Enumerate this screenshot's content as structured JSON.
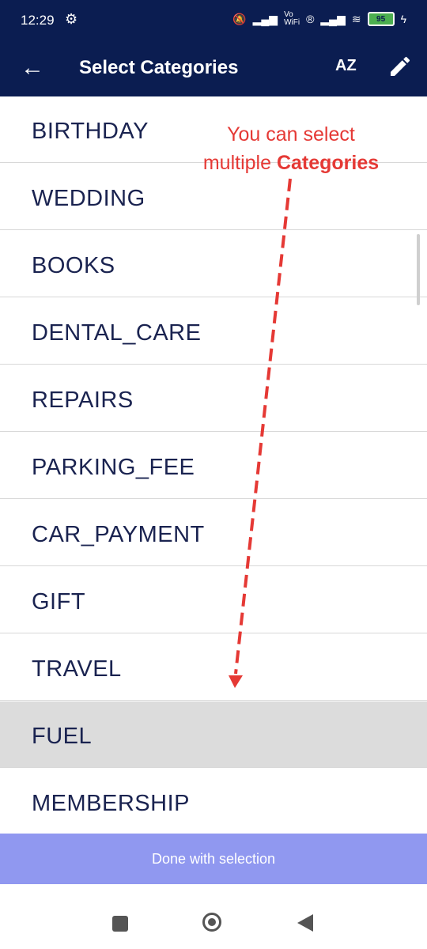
{
  "status_bar": {
    "time": "12:29",
    "battery": "95",
    "icons": [
      "settings-gear-icon",
      "mute-icon",
      "signal-icon",
      "vowifi-icon",
      "registered-icon",
      "wifi-icon",
      "charging-icon"
    ]
  },
  "toolbar": {
    "title": "Select Categories",
    "sort_label": "AZ",
    "icons": [
      "back-arrow-icon",
      "sort-az-icon",
      "edit-pencil-icon"
    ]
  },
  "categories": [
    {
      "label": "BIRTHDAY",
      "selected": false
    },
    {
      "label": "WEDDING",
      "selected": false
    },
    {
      "label": "BOOKS",
      "selected": false
    },
    {
      "label": "DENTAL_CARE",
      "selected": false
    },
    {
      "label": "REPAIRS",
      "selected": false
    },
    {
      "label": "PARKING_FEE",
      "selected": false
    },
    {
      "label": "CAR_PAYMENT",
      "selected": false
    },
    {
      "label": "GIFT",
      "selected": false
    },
    {
      "label": "TRAVEL",
      "selected": false
    },
    {
      "label": "FUEL",
      "selected": true
    },
    {
      "label": "MEMBERSHIP",
      "selected": false
    }
  ],
  "annotation": {
    "line1": "You can select",
    "line2_prefix": "multiple ",
    "line2_bold": "Categories",
    "color": "#e53935"
  },
  "done_button": {
    "label": "Done with selection"
  },
  "colors": {
    "primary": "#0b1d51",
    "done": "#9098f0",
    "selected_row": "#dcdcdc"
  }
}
